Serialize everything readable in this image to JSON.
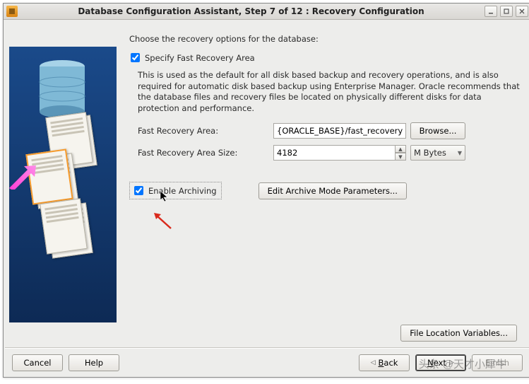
{
  "titlebar": {
    "title": "Database Configuration Assistant, Step 7 of 12 : Recovery Configuration"
  },
  "main": {
    "intro": "Choose the recovery options for the database:",
    "specify_label": "Specify Fast Recovery Area",
    "specify_checked": true,
    "desc": "This is used as the default for all disk based backup and recovery operations, and is also required for automatic disk based backup using Enterprise Manager. Oracle recommends that the database files and recovery files be located on physically different disks for data protection and performance.",
    "fra_label": "Fast Recovery Area:",
    "fra_value": "{ORACLE_BASE}/fast_recovery_a",
    "browse_label": "Browse...",
    "fra_size_label": "Fast Recovery Area Size:",
    "fra_size_value": "4182",
    "size_unit": "M Bytes",
    "enable_arch_label": "Enable Archiving",
    "enable_arch_checked": true,
    "edit_arch_label": "Edit Archive Mode Parameters...",
    "flv_label": "File Location Variables..."
  },
  "footer": {
    "cancel": "Cancel",
    "help": "Help",
    "back": "Back",
    "next": "Next",
    "finish": "Einish"
  },
  "watermark": "头条 @天才小犀牛"
}
